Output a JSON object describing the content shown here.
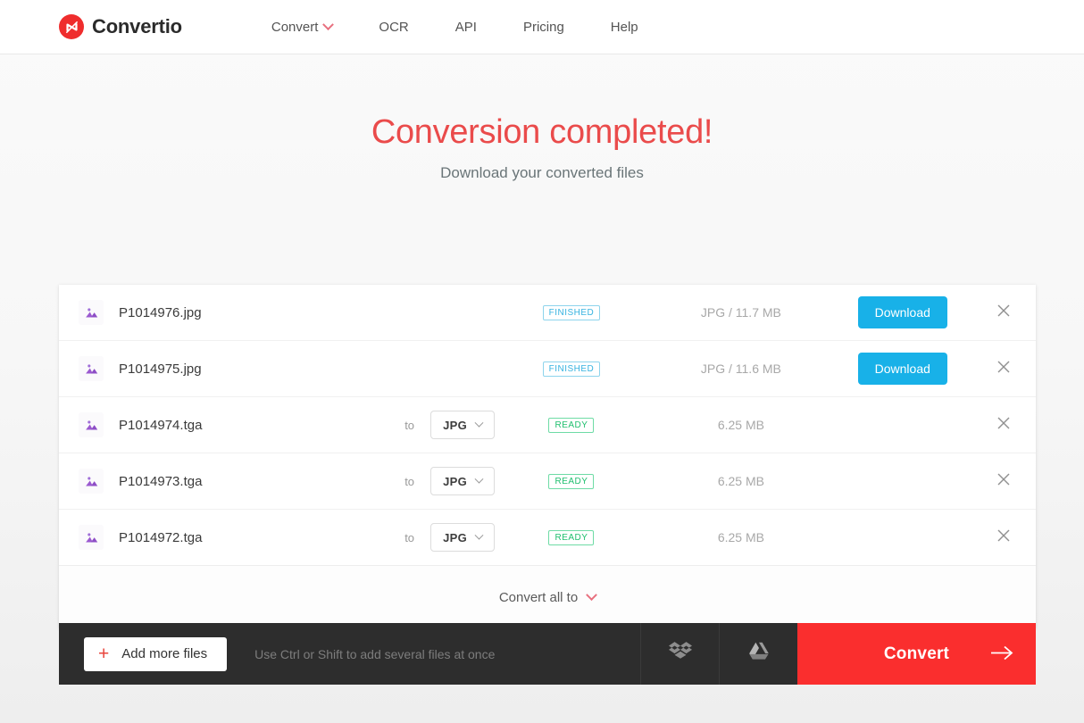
{
  "header": {
    "logo_text": "Convertio",
    "logo_icon": "convertio-logo-icon",
    "nav": [
      {
        "label": "Convert",
        "has_chevron": true
      },
      {
        "label": "OCR",
        "has_chevron": false
      },
      {
        "label": "API",
        "has_chevron": false
      },
      {
        "label": "Pricing",
        "has_chevron": false
      },
      {
        "label": "Help",
        "has_chevron": false
      }
    ]
  },
  "hero": {
    "title": "Conversion completed!",
    "subtitle": "Download your converted files"
  },
  "files": [
    {
      "name": "P1014976.jpg",
      "to_label": "",
      "format": "",
      "status": "FINISHED",
      "status_type": "finished",
      "size": "JPG / 11.7 MB",
      "action": "Download",
      "has_action": true
    },
    {
      "name": "P1014975.jpg",
      "to_label": "",
      "format": "",
      "status": "FINISHED",
      "status_type": "finished",
      "size": "JPG / 11.6 MB",
      "action": "Download",
      "has_action": true
    },
    {
      "name": "P1014974.tga",
      "to_label": "to",
      "format": "JPG",
      "status": "READY",
      "status_type": "ready",
      "size": "6.25 MB",
      "action": "",
      "has_action": false
    },
    {
      "name": "P1014973.tga",
      "to_label": "to",
      "format": "JPG",
      "status": "READY",
      "status_type": "ready",
      "size": "6.25 MB",
      "action": "",
      "has_action": false
    },
    {
      "name": "P1014972.tga",
      "to_label": "to",
      "format": "JPG",
      "status": "READY",
      "status_type": "ready",
      "size": "6.25 MB",
      "action": "",
      "has_action": false
    }
  ],
  "convert_all": {
    "label": "Convert all to"
  },
  "bottom_bar": {
    "add_more_label": "Add more files",
    "add_more_icon": "plus-icon",
    "hint": "Use Ctrl or Shift to add several files at once",
    "dropbox_icon": "dropbox-icon",
    "google_drive_icon": "google-drive-icon",
    "convert_label": "Convert",
    "convert_arrow_icon": "arrow-right-icon"
  },
  "colors": {
    "brand_red": "#fa2e2e",
    "hero_red": "#ea4b4b",
    "download_blue": "#18b1e8",
    "finished_badge": "#37b3e0",
    "ready_badge": "#1fbf6e",
    "file_icon_purple": "#9b59d0",
    "bar_dark": "#2d2d2d"
  }
}
